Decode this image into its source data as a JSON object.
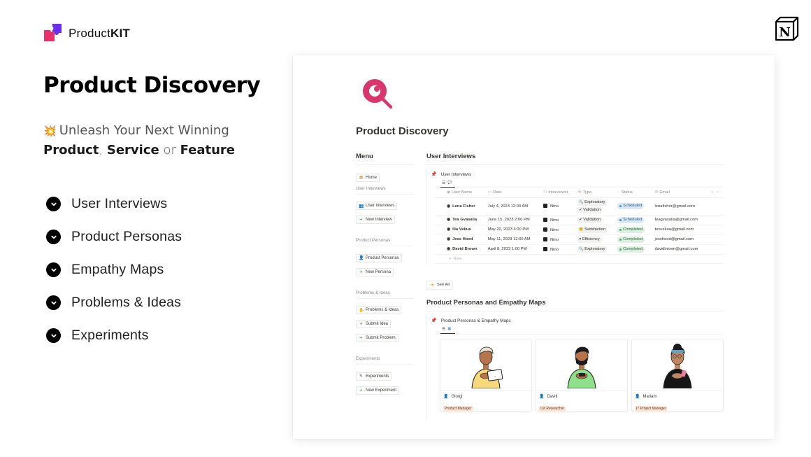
{
  "brand": {
    "name_regular": "Product",
    "name_bold": "KIT",
    "logo_icon": "puzzle-icon"
  },
  "hero": {
    "title": "Product Discovery",
    "tagline_emoji": "💥",
    "tagline_line1": "Unleash Your Next Winning",
    "tagline_word1": "Product",
    "tagline_sep1": ", ",
    "tagline_word2": "Service",
    "tagline_sep2": " or ",
    "tagline_word3": "Feature"
  },
  "features": [
    {
      "label": "User Interviews",
      "icon": "chevron-down-circle-icon"
    },
    {
      "label": "Product Personas",
      "icon": "chevron-down-circle-icon"
    },
    {
      "label": "Empathy Maps",
      "icon": "chevron-down-circle-icon"
    },
    {
      "label": "Problems & Ideas",
      "icon": "chevron-down-circle-icon"
    },
    {
      "label": "Experiments",
      "icon": "chevron-down-circle-icon"
    }
  ],
  "notion_logo": {
    "letter": "N",
    "icon": "notion-logo-icon"
  },
  "page": {
    "icon": "magnifier-eye-icon",
    "icon_color": "#d9376b",
    "title": "Product Discovery",
    "menu": {
      "heading": "Menu",
      "home": {
        "label": "Home",
        "icon": "grid-icon"
      },
      "sections": [
        {
          "label": "User Interviews",
          "buttons": [
            {
              "label": "User Interviews",
              "icon": "people-icon"
            },
            {
              "label": "New Interview",
              "icon": "plus-icon"
            }
          ]
        },
        {
          "label": "Product Personas",
          "buttons": [
            {
              "label": "Product Personas",
              "icon": "person-icon"
            },
            {
              "label": "New Persona",
              "icon": "plus-icon"
            }
          ]
        },
        {
          "label": "Problems & Ideas",
          "buttons": [
            {
              "label": "Problems & Ideas",
              "icon": "hand-icon"
            },
            {
              "label": "Submit Idea",
              "icon": "plus-icon"
            },
            {
              "label": "Submit Problem",
              "icon": "plus-icon"
            }
          ]
        },
        {
          "label": "Experiments",
          "buttons": [
            {
              "label": "Experiments",
              "icon": "pencil-icon"
            },
            {
              "label": "New Experiment",
              "icon": "plus-icon"
            }
          ]
        }
      ]
    },
    "interviews": {
      "section_title": "User Interviews",
      "db_title": "User Interviews",
      "columns": [
        "User Name",
        "Date",
        "Interviewer",
        "Type",
        "Status",
        "Email"
      ],
      "rows": [
        {
          "name": "Lena Fisher",
          "date": "July 4, 2023 12:00 AM",
          "interviewer": "Nino",
          "types": [
            {
              "label": "Exploratory",
              "icon": "🔍"
            },
            {
              "label": "Validation",
              "icon": "✔"
            }
          ],
          "status": "Scheduled",
          "email": "lenafisher@gmail.com"
        },
        {
          "name": "Tea Gvasalia",
          "date": "June 15, 2023 2:00 PM",
          "interviewer": "Nino",
          "types": [
            {
              "label": "Validation",
              "icon": "✔"
            }
          ],
          "status": "Scheduled",
          "email": "teagvasalia@gmail.com"
        },
        {
          "name": "Ilia Vekua",
          "date": "May 20, 2023 6:00 PM",
          "interviewer": "Nino",
          "types": [
            {
              "label": "Satisfaction",
              "icon": "😊"
            }
          ],
          "status": "Completed",
          "email": "teovekua@gmail.com"
        },
        {
          "name": "Jess Hood",
          "date": "May 11, 2023 12:00 AM",
          "interviewer": "Nino",
          "types": [
            {
              "label": "Efficiency",
              "icon": "♥"
            }
          ],
          "status": "Completed",
          "email": "jesshood@gmail.com"
        },
        {
          "name": "David Brown",
          "date": "April 8, 2023 1:00 PM",
          "interviewer": "Nino",
          "types": [
            {
              "label": "Exploratory",
              "icon": "🔍"
            }
          ],
          "status": "Completed",
          "email": "davidbrown@gmail.com"
        }
      ],
      "status_colors": {
        "Scheduled": {
          "bg": "#dbe9f7",
          "fg": "#2c5a85",
          "dot": "#4a8ad0"
        },
        "Completed": {
          "bg": "#dcefe0",
          "fg": "#2f6b3c",
          "dot": "#5aa86a"
        }
      },
      "new_label": "New",
      "see_all_label": "See All"
    },
    "personas": {
      "section_title": "Product Personas and Empathy Maps",
      "db_title": "Product Personas & Empathy Maps",
      "cards": [
        {
          "name": "Giorgi",
          "role": "Product Manager",
          "shirt": "#f7d87a",
          "skin": "#b7744a",
          "hair": "#e8e2d0"
        },
        {
          "name": "Daviti",
          "role": "UX Researcher",
          "shirt": "#8fe08a",
          "skin": "#b7744a",
          "hair": "#1b1b1b"
        },
        {
          "name": "Mariam",
          "role": "IT Project Manager",
          "shirt": "#161616",
          "skin": "#c08660",
          "hair": "#1b1b1b"
        }
      ]
    }
  }
}
